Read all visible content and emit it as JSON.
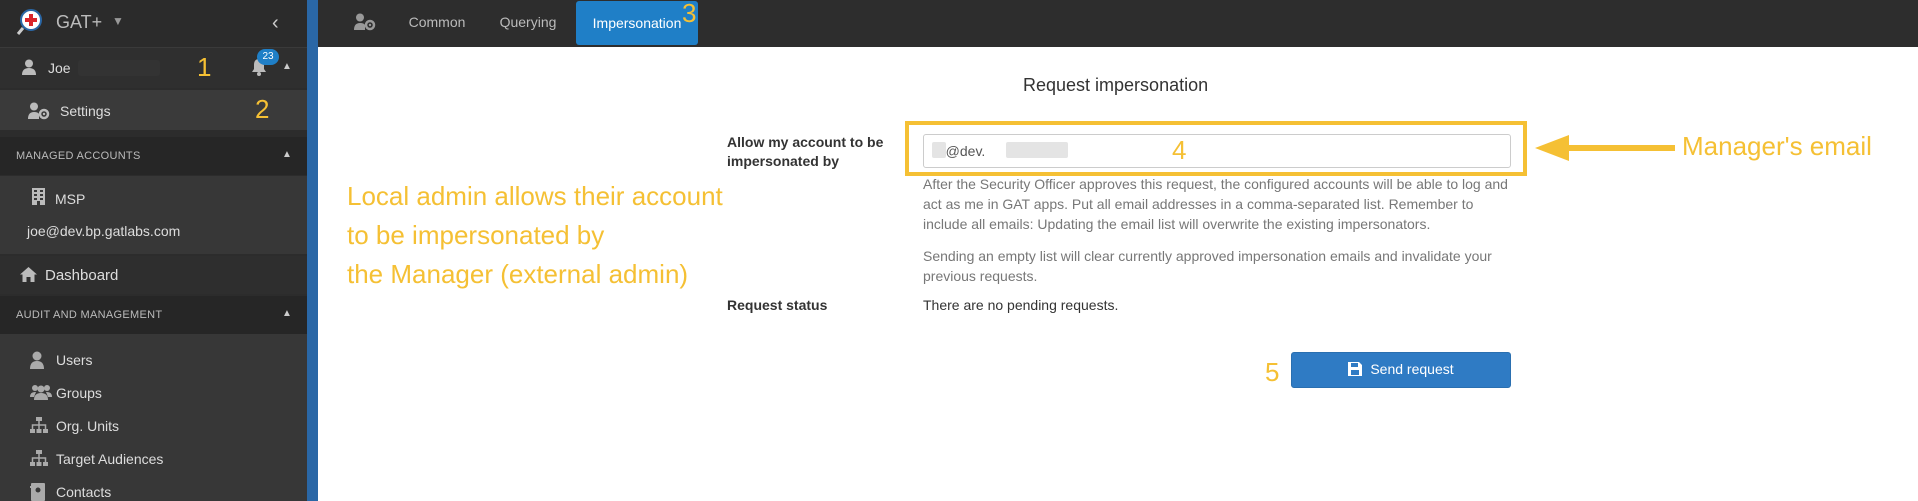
{
  "app": {
    "name": "GAT+"
  },
  "user": {
    "name": "Joe",
    "notifications_count": "23",
    "annotation": "1"
  },
  "settings": {
    "label": "Settings",
    "annotation": "2"
  },
  "managed_accounts": {
    "title": "MANAGED ACCOUNTS",
    "org_label": "MSP",
    "account_email": "joe@dev.bp.gatlabs.com"
  },
  "dashboard": {
    "label": "Dashboard"
  },
  "audit": {
    "title": "AUDIT AND MANAGEMENT",
    "items": [
      {
        "label": "Users",
        "icon": "user-icon"
      },
      {
        "label": "Groups",
        "icon": "users-icon"
      },
      {
        "label": "Org. Units",
        "icon": "sitemap-icon"
      },
      {
        "label": "Target Audiences",
        "icon": "sitemap-icon"
      },
      {
        "label": "Contacts",
        "icon": "contact-book-icon"
      }
    ]
  },
  "tabs": {
    "common": "Common",
    "querying": "Querying",
    "impersonation": "Impersonation",
    "annotation": "3"
  },
  "main": {
    "title": "Request impersonation",
    "allow_label": "Allow my account to be impersonated by",
    "email_value": "m@dev.            .com",
    "email_annotation": "4",
    "help_text_1": "After the Security Officer approves this request, the configured accounts will be able to log and act as me in GAT apps. Put all email addresses in a comma-separated list. Remember to include all emails: Updating the email list will overwrite the existing impersonators.",
    "help_text_2": "Sending an empty list will clear currently approved impersonation emails and invalidate your previous requests.",
    "status_label": "Request status",
    "status_value": "There are no pending requests.",
    "send_label": "Send request",
    "send_annotation": "5"
  },
  "annotations": {
    "local_admin": [
      "Local admin allows their account",
      "to be impersonated by",
      "the Manager (external admin)"
    ],
    "manager_email": "Manager's email"
  },
  "colors": {
    "accent": "#1f7fc7",
    "annotation": "#f5c034",
    "sidebar_bg": "#2c2c2c",
    "divider": "#2a67a6"
  }
}
